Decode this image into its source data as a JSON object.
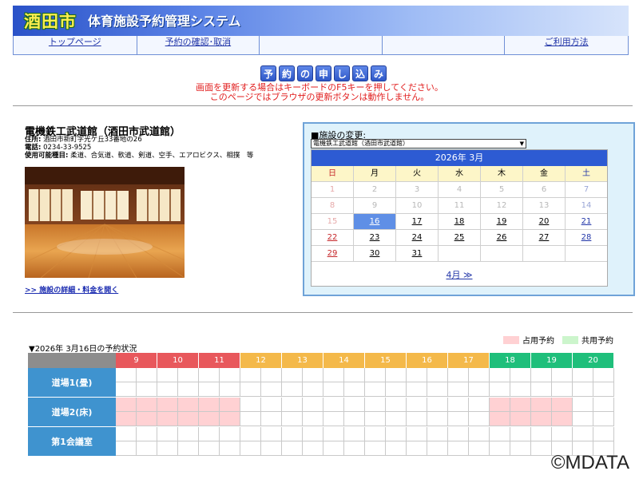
{
  "header": {
    "logo_text": "酒田市",
    "system_title": "体育施設予約管理システム"
  },
  "nav": [
    {
      "label": "トップページ",
      "width": 155
    },
    {
      "label": "予約の確認･取消",
      "width": 154
    },
    {
      "label": "",
      "width": 154
    },
    {
      "label": "",
      "width": 154
    },
    {
      "label": "ご利用方法",
      "width": 154
    }
  ],
  "banner": [
    "予",
    "約",
    "の",
    "申",
    "し",
    "込",
    "み"
  ],
  "notice": {
    "line1": "画面を更新する場合はキーボードのF5キーを押してください。",
    "line2": "このページではブラウザの更新ボタンは動作しません。"
  },
  "facility": {
    "name": "電機鉄工武道館（酒田市武道館）",
    "address_label": "住所:",
    "address": "酒田市新町字光ケ丘33番地の26",
    "phone_label": "電話:",
    "phone": "0234-33-9525",
    "uses_label": "使用可能種目:",
    "uses": "柔道、合気道、軟道、剣道、空手、エアロビクス、相撲　等",
    "detail_link": ">> 施設の詳細・料金を開く"
  },
  "calendar": {
    "change_label": "■施設の変更:",
    "selected_facility": "電機鉄工武道館（酒田市武道館）",
    "month_label": "2026年 3月",
    "weekdays": [
      "日",
      "月",
      "火",
      "水",
      "木",
      "金",
      "土"
    ],
    "weeks": [
      [
        "1",
        "2",
        "3",
        "4",
        "5",
        "6",
        "7"
      ],
      [
        "8",
        "9",
        "10",
        "11",
        "12",
        "13",
        "14"
      ],
      [
        "15",
        "16",
        "17",
        "18",
        "19",
        "20",
        "21"
      ],
      [
        "22",
        "23",
        "24",
        "25",
        "26",
        "27",
        "28"
      ],
      [
        "29",
        "30",
        "31",
        "",
        "",
        "",
        ""
      ]
    ],
    "today": "16",
    "next_link": "4月 ≫"
  },
  "status": {
    "title": "▼2026年 3月16日の予約状況",
    "legend_occupied": "占用予約",
    "legend_shared": "共用予約",
    "colors": {
      "occupied": "#ffd1d3",
      "shared": "#ccf5cc",
      "morning": "#e8585c",
      "afternoon": "#f4b94a",
      "evening": "#1fbf7b",
      "label_bg": "#3f93cf"
    },
    "hours": [
      "9",
      "10",
      "11",
      "12",
      "13",
      "14",
      "15",
      "16",
      "17",
      "18",
      "19",
      "20"
    ],
    "rooms": [
      {
        "name": "道場1(畳)",
        "occupied": []
      },
      {
        "name": "道場2(床)",
        "occupied": [
          0,
          1,
          2,
          3,
          4,
          5,
          18,
          19,
          20,
          21
        ]
      },
      {
        "name": "第1会議室",
        "occupied": []
      }
    ]
  },
  "watermark": "©MDATA"
}
